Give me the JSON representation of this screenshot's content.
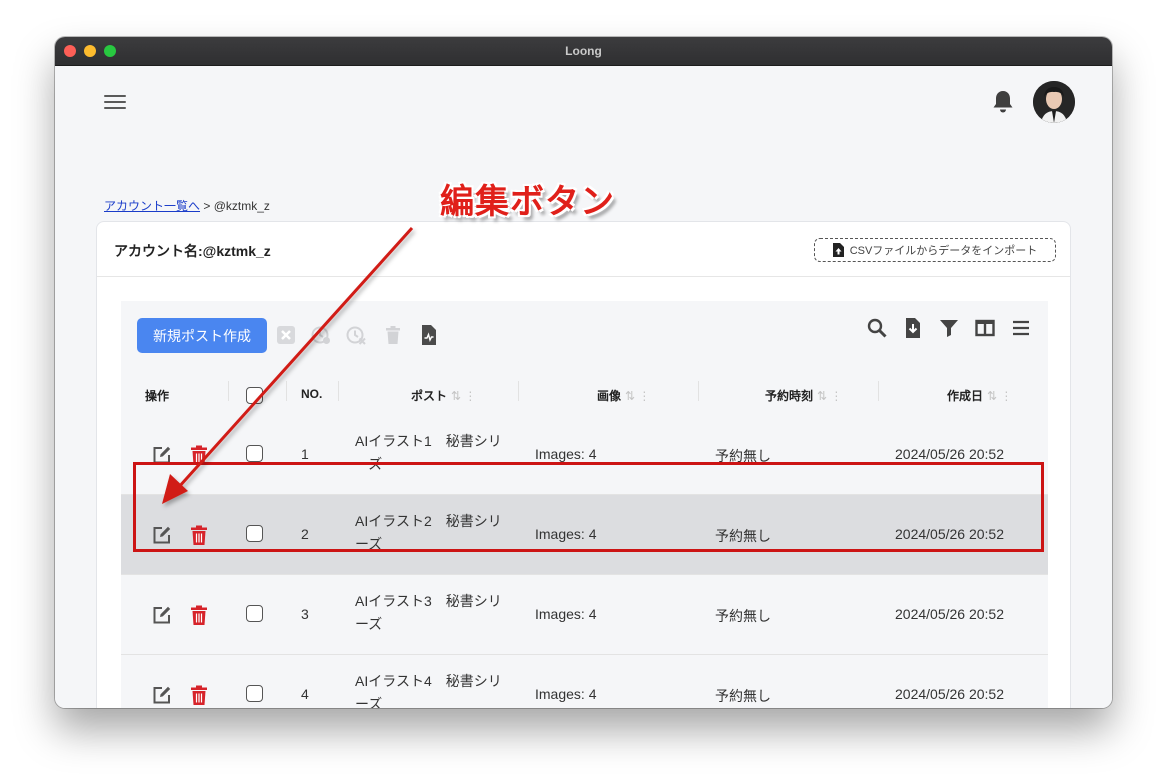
{
  "window": {
    "title": "Loong"
  },
  "breadcrumb": {
    "link": "アカウント一覧へ",
    "separator": ">",
    "current": "@kztmk_z"
  },
  "card": {
    "account_name": "アカウント名:@kztmk_z",
    "import_label": "CSVファイルからデータをインポート"
  },
  "toolbar": {
    "new_post_label": "新規ポスト作成"
  },
  "table": {
    "columns": [
      "操作",
      "NO.",
      "ポスト",
      "画像",
      "予約時刻",
      "作成日"
    ],
    "rows": [
      {
        "no": "1",
        "post_line1": "AIイラスト1　秘書シリ",
        "post_line2": "ーズ",
        "images": "Images: 4",
        "scheduled": "予約無し",
        "created": "2024/05/26 20:52"
      },
      {
        "no": "2",
        "post_line1": "AIイラスト2　秘書シリ",
        "post_line2": "ーズ",
        "images": "Images: 4",
        "scheduled": "予約無し",
        "created": "2024/05/26 20:52"
      },
      {
        "no": "3",
        "post_line1": "AIイラスト3　秘書シリ",
        "post_line2": "ーズ",
        "images": "Images: 4",
        "scheduled": "予約無し",
        "created": "2024/05/26 20:52"
      },
      {
        "no": "4",
        "post_line1": "AIイラスト4　秘書シリ",
        "post_line2": "ーズ",
        "images": "Images: 4",
        "scheduled": "予約無し",
        "created": "2024/05/26 20:52"
      }
    ],
    "highlighted_row": 2
  },
  "annotation": {
    "text": "編集ボタン"
  },
  "colors": {
    "primary": "#4a86f0",
    "danger": "#d6232a",
    "highlight_box": "#cc1414",
    "annotation": "#e0201a"
  },
  "icons": [
    "hamburger-icon",
    "bell-icon",
    "avatar",
    "file-upload-icon",
    "clear-selection-icon",
    "schedule-icon",
    "unschedule-icon",
    "trash-icon",
    "file-chart-icon",
    "search-icon",
    "download-icon",
    "filter-icon",
    "columns-icon",
    "density-icon",
    "edit-icon",
    "delete-icon",
    "sort-icon",
    "column-menu-icon"
  ]
}
